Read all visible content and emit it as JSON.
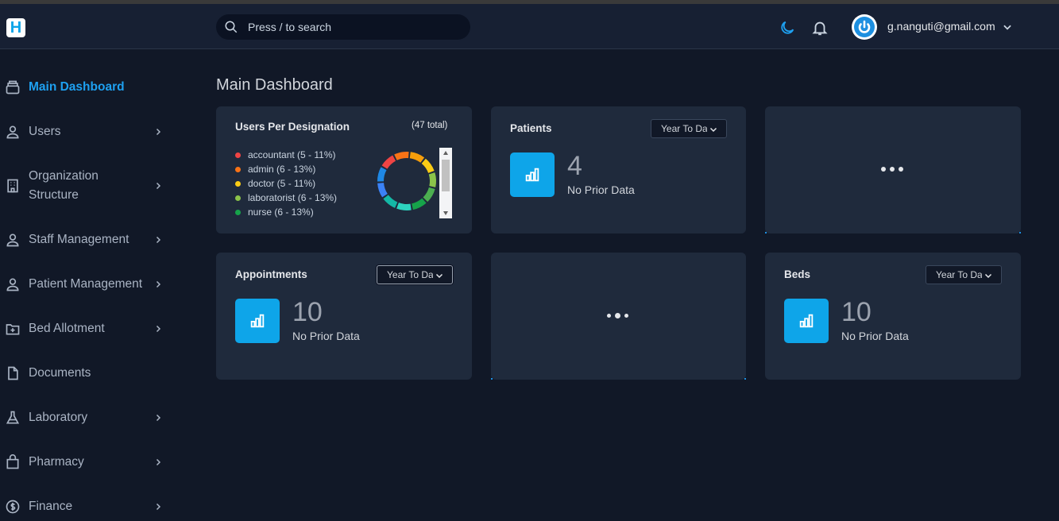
{
  "header": {
    "logo_letter": "H",
    "search_placeholder": "Press / to search",
    "user_email": "g.nanguti@gmail.com"
  },
  "sidebar": {
    "items": [
      {
        "label": "Main Dashboard",
        "icon": "dashboard-icon",
        "active": true,
        "has_chevron": false
      },
      {
        "label": "Users",
        "icon": "user-icon",
        "has_chevron": true
      },
      {
        "label": "Organization",
        "label2": "Structure",
        "icon": "building-icon",
        "has_chevron": true
      },
      {
        "label": "Staff Management",
        "icon": "user-icon",
        "has_chevron": true
      },
      {
        "label": "Patient Management",
        "icon": "user-icon",
        "has_chevron": true
      },
      {
        "label": "Bed Allotment",
        "icon": "folder-plus-icon",
        "has_chevron": true
      },
      {
        "label": "Documents",
        "icon": "document-icon",
        "has_chevron": false
      },
      {
        "label": "Laboratory",
        "icon": "flask-icon",
        "has_chevron": true
      },
      {
        "label": "Pharmacy",
        "icon": "bag-icon",
        "has_chevron": true
      },
      {
        "label": "Finance",
        "icon": "dollar-icon",
        "has_chevron": true
      }
    ]
  },
  "page": {
    "title": "Main Dashboard"
  },
  "users_per_designation": {
    "title": "Users Per Designation",
    "total": "(47 total)",
    "legend": [
      {
        "label": "accountant (5 - 11%)",
        "color": "#ef4444"
      },
      {
        "label": "admin (6 - 13%)",
        "color": "#f97316"
      },
      {
        "label": "doctor (5 - 11%)",
        "color": "#facc15"
      },
      {
        "label": "laboratorist (6 - 13%)",
        "color": "#8bc34a"
      },
      {
        "label": "nurse (6 - 13%)",
        "color": "#16a34a"
      }
    ],
    "donut_colors": [
      "#f59e0b",
      "#facc15",
      "#8bc34a",
      "#4caf50",
      "#16a34a",
      "#2dd4bf",
      "#14b8a6",
      "#3b82f6",
      "#1e88e5",
      "#ef4444",
      "#f97316"
    ]
  },
  "patients": {
    "title": "Patients",
    "filter": "Year To Date",
    "value": "4",
    "sub": "No Prior Data"
  },
  "appointments": {
    "title": "Appointments",
    "filter": "Year To Date",
    "value": "10",
    "sub": "No Prior Data"
  },
  "beds": {
    "title": "Beds",
    "filter": "Year To Date",
    "value": "10",
    "sub": "No Prior Data"
  }
}
